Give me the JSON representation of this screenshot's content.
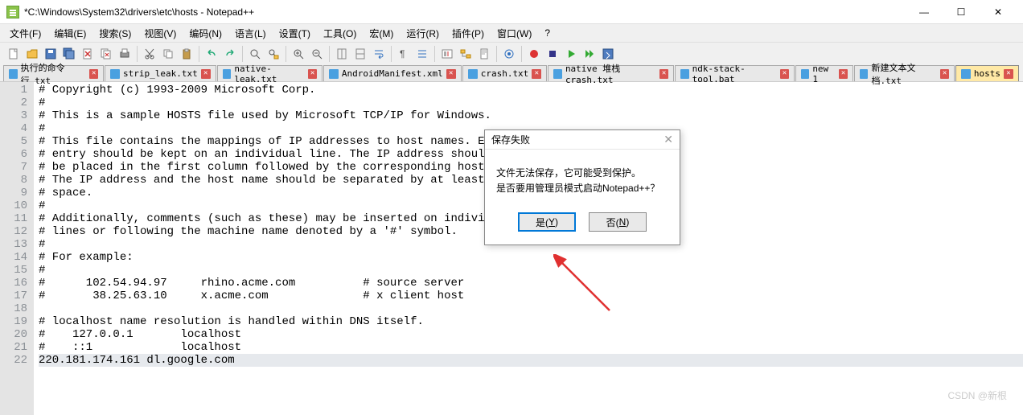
{
  "window": {
    "title": "*C:\\Windows\\System32\\drivers\\etc\\hosts - Notepad++",
    "min": "—",
    "max": "☐",
    "close": "✕"
  },
  "menu": {
    "items": [
      "文件(F)",
      "编辑(E)",
      "搜索(S)",
      "视图(V)",
      "编码(N)",
      "语言(L)",
      "设置(T)",
      "工具(O)",
      "宏(M)",
      "运行(R)",
      "插件(P)",
      "窗口(W)",
      "?"
    ]
  },
  "tabs": [
    {
      "label": "执行的命令行.txt",
      "active": false
    },
    {
      "label": "strip_leak.txt",
      "active": false
    },
    {
      "label": "native-leak.txt",
      "active": false
    },
    {
      "label": "AndroidManifest.xml",
      "active": false
    },
    {
      "label": "crash.txt",
      "active": false
    },
    {
      "label": "native 堆栈crash.txt",
      "active": false
    },
    {
      "label": "ndk-stack-tool.bat",
      "active": false
    },
    {
      "label": "new 1",
      "active": false
    },
    {
      "label": "新建文本文档.txt",
      "active": false
    },
    {
      "label": "hosts",
      "active": true
    }
  ],
  "lines": [
    "# Copyright (c) 1993-2009 Microsoft Corp.",
    "#",
    "# This is a sample HOSTS file used by Microsoft TCP/IP for Windows.",
    "#",
    "# This file contains the mappings of IP addresses to host names. Each",
    "# entry should be kept on an individual line. The IP address should",
    "# be placed in the first column followed by the corresponding host name.",
    "# The IP address and the host name should be separated by at least one",
    "# space.",
    "#",
    "# Additionally, comments (such as these) may be inserted on individual",
    "# lines or following the machine name denoted by a '#' symbol.",
    "#",
    "# For example:",
    "#",
    "#      102.54.94.97     rhino.acme.com          # source server",
    "#       38.25.63.10     x.acme.com              # x client host",
    "",
    "# localhost name resolution is handled within DNS itself.",
    "#\t127.0.0.1       localhost",
    "#\t::1             localhost",
    "220.181.174.161 dl.google.com"
  ],
  "dialog": {
    "title": "保存失败",
    "line1": "文件无法保存，它可能受到保护。",
    "line2": "是否要用管理员模式启动Notepad++？",
    "yes": "是(Y)",
    "no": "否(N)"
  },
  "watermark": "CSDN @新根"
}
